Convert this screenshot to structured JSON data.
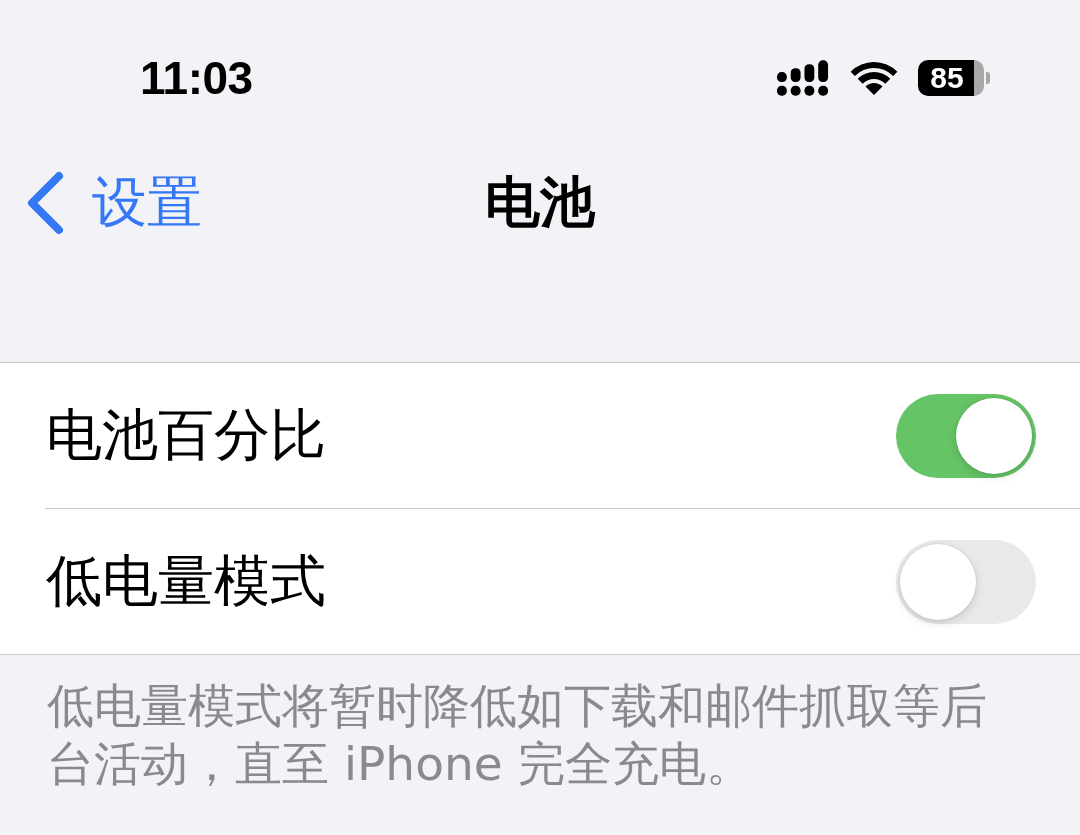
{
  "status_bar": {
    "time": "11:03",
    "battery": "85"
  },
  "nav": {
    "back": "设置",
    "title": "电池"
  },
  "rows": [
    {
      "label": "电池百分比",
      "on": true
    },
    {
      "label": "低电量模式",
      "on": false
    }
  ],
  "footer": "低电量模式将暂时降低如下载和邮件抓取等后台活动，直至 iPhone 完全充电。"
}
